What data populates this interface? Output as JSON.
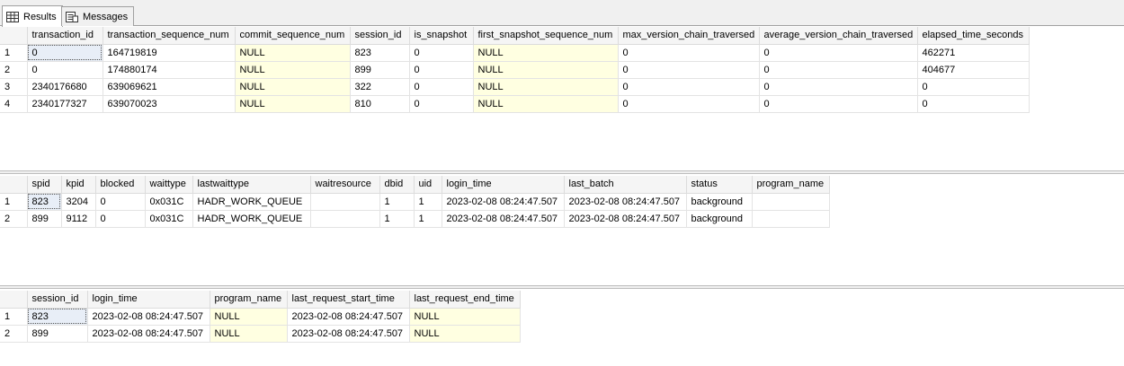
{
  "tabs": [
    {
      "label": "Results",
      "icon": "grid-icon",
      "active": true
    },
    {
      "label": "Messages",
      "icon": "messages-icon",
      "active": false
    }
  ],
  "grid1": {
    "columns": [
      "transaction_id",
      "transaction_sequence_num",
      "commit_sequence_num",
      "session_id",
      "is_snapshot",
      "first_snapshot_sequence_num",
      "max_version_chain_traversed",
      "average_version_chain_traversed",
      "elapsed_time_seconds"
    ],
    "rows": [
      {
        "num": "1",
        "cells": [
          "0",
          "164719819",
          "NULL",
          "823",
          "0",
          "NULL",
          "0",
          "0",
          "462271"
        ]
      },
      {
        "num": "2",
        "cells": [
          "0",
          "174880174",
          "NULL",
          "899",
          "0",
          "NULL",
          "0",
          "0",
          "404677"
        ]
      },
      {
        "num": "3",
        "cells": [
          "2340176680",
          "639069621",
          "NULL",
          "322",
          "0",
          "NULL",
          "0",
          "0",
          "0"
        ]
      },
      {
        "num": "4",
        "cells": [
          "2340177327",
          "639070023",
          "NULL",
          "810",
          "0",
          "NULL",
          "0",
          "0",
          "0"
        ]
      }
    ]
  },
  "grid2": {
    "columns": [
      "spid",
      "kpid",
      "blocked",
      "waittype",
      "lastwaittype",
      "waitresource",
      "dbid",
      "uid",
      "login_time",
      "last_batch",
      "status",
      "program_name"
    ],
    "rows": [
      {
        "num": "1",
        "cells": [
          "823",
          "3204",
          "0",
          "0x031C",
          "HADR_WORK_QUEUE",
          "",
          "1",
          "1",
          "2023-02-08 08:24:47.507",
          "2023-02-08 08:24:47.507",
          "background",
          ""
        ]
      },
      {
        "num": "2",
        "cells": [
          "899",
          "9112",
          "0",
          "0x031C",
          "HADR_WORK_QUEUE",
          "",
          "1",
          "1",
          "2023-02-08 08:24:47.507",
          "2023-02-08 08:24:47.507",
          "background",
          ""
        ]
      }
    ]
  },
  "grid3": {
    "columns": [
      "session_id",
      "login_time",
      "program_name",
      "last_request_start_time",
      "last_request_end_time"
    ],
    "rows": [
      {
        "num": "1",
        "cells": [
          "823",
          "2023-02-08 08:24:47.507",
          "NULL",
          "2023-02-08 08:24:47.507",
          "NULL"
        ]
      },
      {
        "num": "2",
        "cells": [
          "899",
          "2023-02-08 08:24:47.507",
          "NULL",
          "2023-02-08 08:24:47.507",
          "NULL"
        ]
      }
    ]
  }
}
